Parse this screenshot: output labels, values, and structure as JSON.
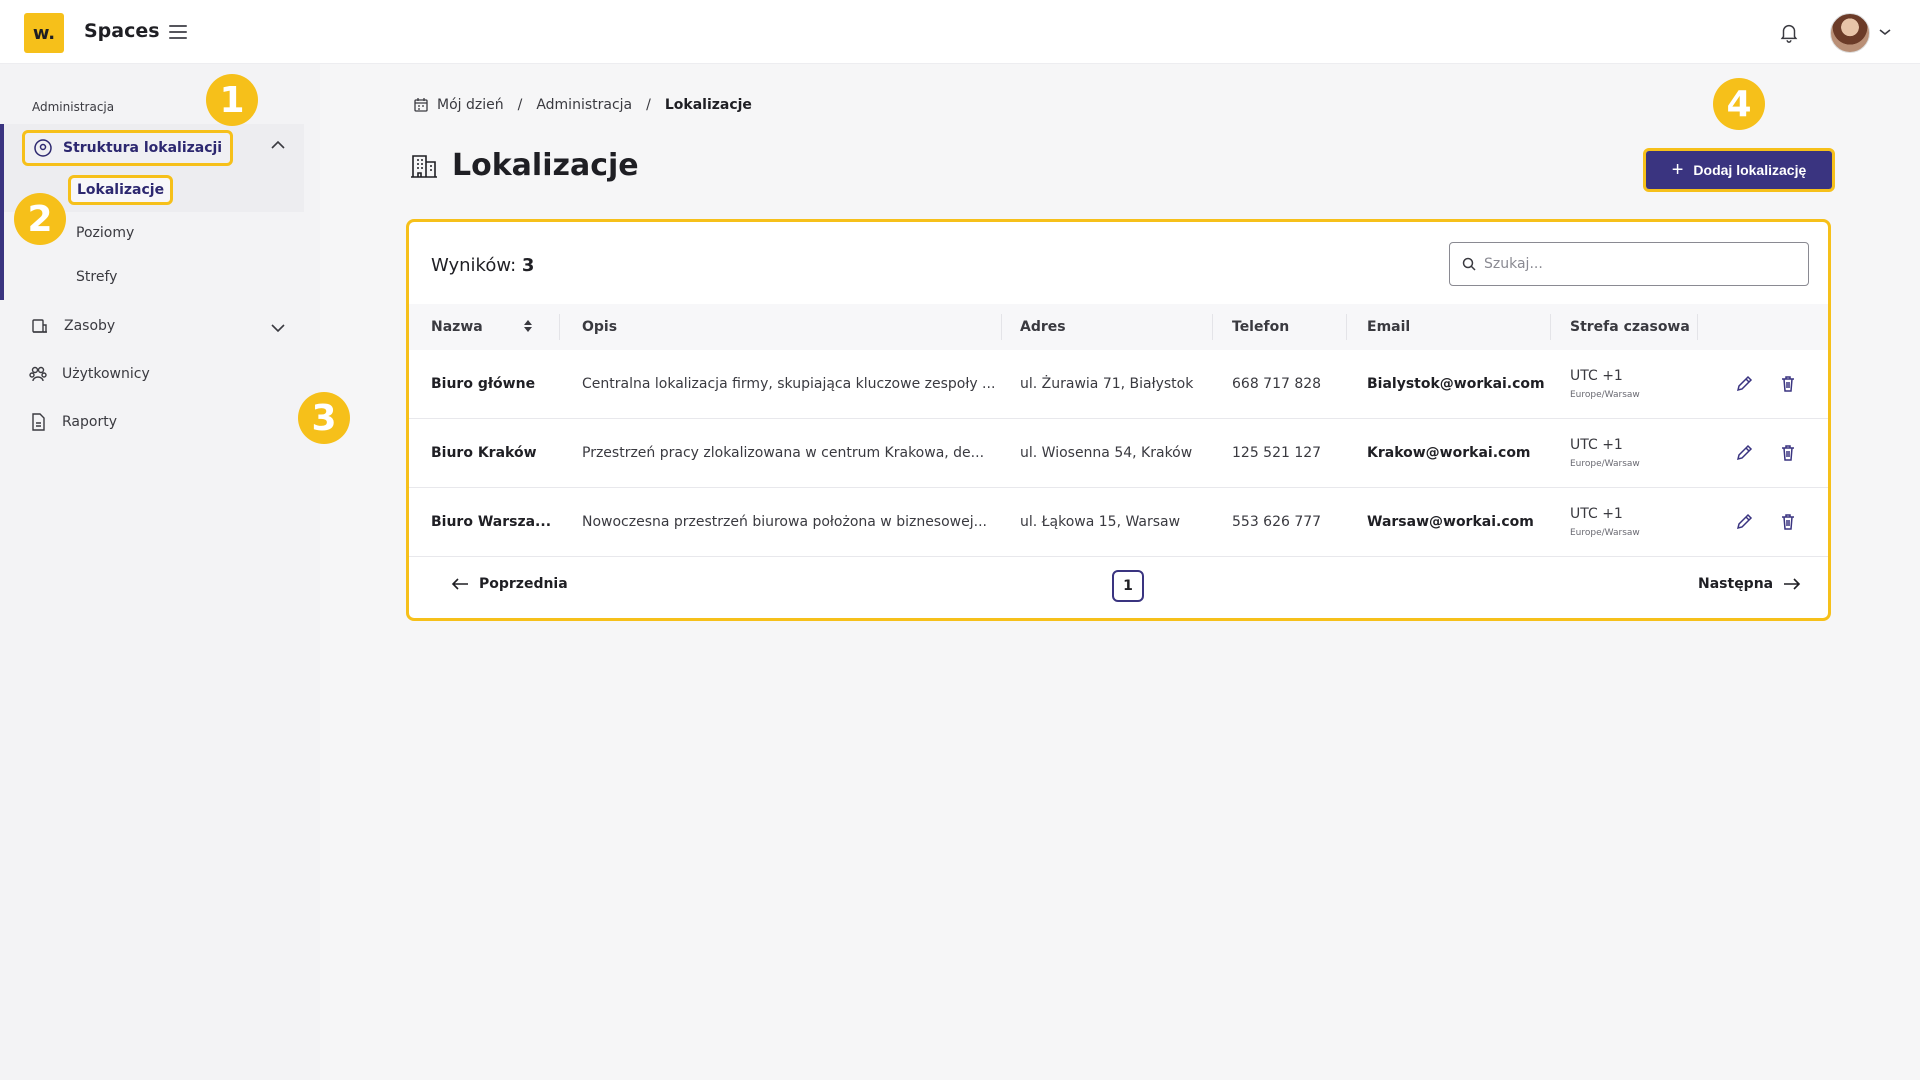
{
  "header": {
    "logo_text": "w.",
    "app_title": "Spaces"
  },
  "sidebar": {
    "section_label": "Administracja",
    "parent_item": "Struktura lokalizacji",
    "sub_items": [
      "Lokalizacje",
      "Poziomy",
      "Strefy"
    ],
    "items": [
      "Zasoby",
      "Użytkownicy",
      "Raporty"
    ]
  },
  "badges": [
    "1",
    "2",
    "3",
    "4"
  ],
  "breadcrumb": {
    "items": [
      "Mój dzień",
      "Administracja"
    ],
    "current": "Lokalizacje",
    "separator": "/"
  },
  "page": {
    "title": "Lokalizacje",
    "add_button": "Dodaj lokalizację"
  },
  "table": {
    "results_label": "Wyników:",
    "results_count": "3",
    "search_placeholder": "Szukaj...",
    "columns": [
      "Nazwa",
      "Opis",
      "Adres",
      "Telefon",
      "Email",
      "Strefa czasowa"
    ],
    "rows": [
      {
        "name": "Biuro główne",
        "description": "Centralna lokalizacja firmy, skupiająca kluczowe zespoły ...",
        "address": "ul. Żurawia 71, Białystok",
        "phone": "668 717 828",
        "email": "Bialystok@workai.com",
        "tz": "UTC +1",
        "tz_region": "Europe/Warsaw"
      },
      {
        "name": "Biuro Kraków",
        "description": "Przestrzeń pracy zlokalizowana w centrum Krakowa, de...",
        "address": "ul. Wiosenna 54, Kraków",
        "phone": "125 521 127",
        "email": "Krakow@workai.com",
        "tz": "UTC +1",
        "tz_region": "Europe/Warsaw"
      },
      {
        "name": "Biuro Warsza...",
        "description": "Nowoczesna przestrzeń biurowa położona w biznesowej...",
        "address": "ul. Łąkowa 15, Warsaw",
        "phone": "553 626 777",
        "email": "Warsaw@workai.com",
        "tz": "UTC +1",
        "tz_region": "Europe/Warsaw"
      }
    ]
  },
  "pagination": {
    "prev": "Poprzednia",
    "next": "Następna",
    "current_page": "1"
  },
  "colors": {
    "accent": "#3a3480",
    "highlight": "#f6c01a",
    "logo": "#f6c01a"
  },
  "icons": {
    "menu": "hamburger-icon",
    "notifications": "bell-icon",
    "location": "location-pin-icon",
    "resources": "resources-icon",
    "users": "users-icon",
    "reports": "report-icon",
    "calendar": "calendar-icon",
    "building": "building-icon",
    "search": "search-icon",
    "edit": "pencil-icon",
    "delete": "trash-icon"
  }
}
